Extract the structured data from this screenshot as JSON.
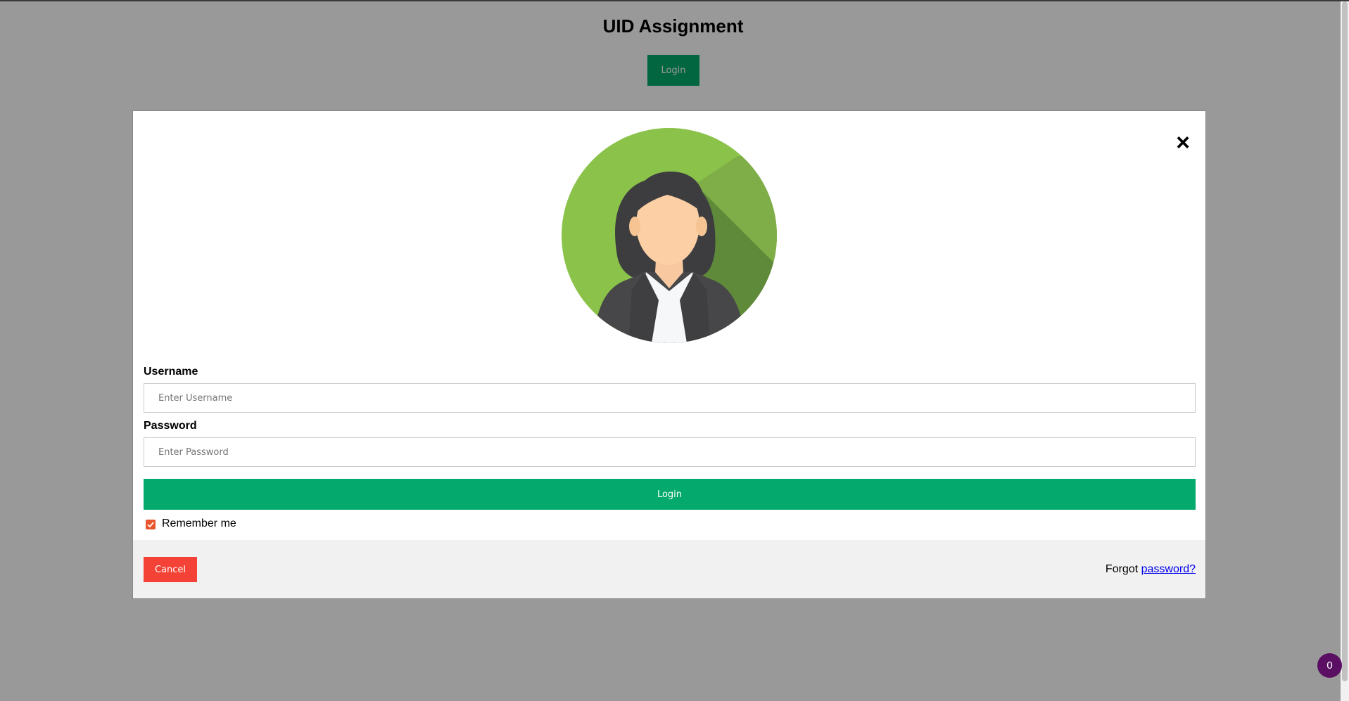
{
  "page": {
    "title": "UID Assignment",
    "open_button_label": "Login"
  },
  "login_modal": {
    "close_symbol": "×",
    "avatar_icon": "woman-avatar-icon",
    "username": {
      "label": "Username",
      "placeholder": "Enter Username",
      "value": ""
    },
    "password": {
      "label": "Password",
      "placeholder": "Enter Password",
      "value": ""
    },
    "submit_label": "Login",
    "remember_me": {
      "label": "Remember me",
      "checked": true
    },
    "footer": {
      "cancel_label": "Cancel",
      "forgot_prefix": "Forgot",
      "forgot_link": "password?"
    }
  },
  "notification_badge": {
    "count": "0"
  },
  "colors": {
    "primary_green": "#04AA6D",
    "cancel_red": "#f44336",
    "checkbox_orange": "#e8552d",
    "badge_purple": "#5a0f63",
    "avatar_green": "#8bc34a"
  }
}
